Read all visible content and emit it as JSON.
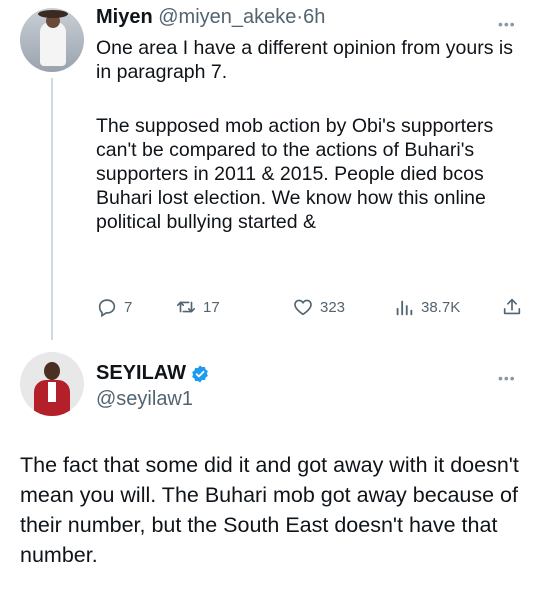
{
  "tweet1": {
    "name": "Miyen",
    "handle": "@miyen_akeke",
    "dot": "·",
    "time": "6h",
    "more": "•••",
    "paragraph1": "One area I have a different opinion from yours is in paragraph 7.",
    "paragraph2": "The supposed mob action by Obi's supporters can't be compared to the actions of Buhari's supporters in 2011 & 2015. People died bcos Buhari lost election. We know how this online political bullying started &",
    "actions": {
      "replies": "7",
      "retweets": "17",
      "likes": "323",
      "views": "38.7K"
    },
    "icons": {
      "reply": "reply-icon",
      "retweet": "retweet-icon",
      "like": "heart-icon",
      "views": "views-icon",
      "share": "share-icon"
    }
  },
  "tweet2": {
    "name": "SEYILAW",
    "handle": "@seyilaw1",
    "more": "•••",
    "verified_color": "#1d9bf0",
    "body": "The fact that some did it and got away with it doesn't mean you will. The Buhari mob got away because of their number, but the South East doesn't have that number."
  }
}
